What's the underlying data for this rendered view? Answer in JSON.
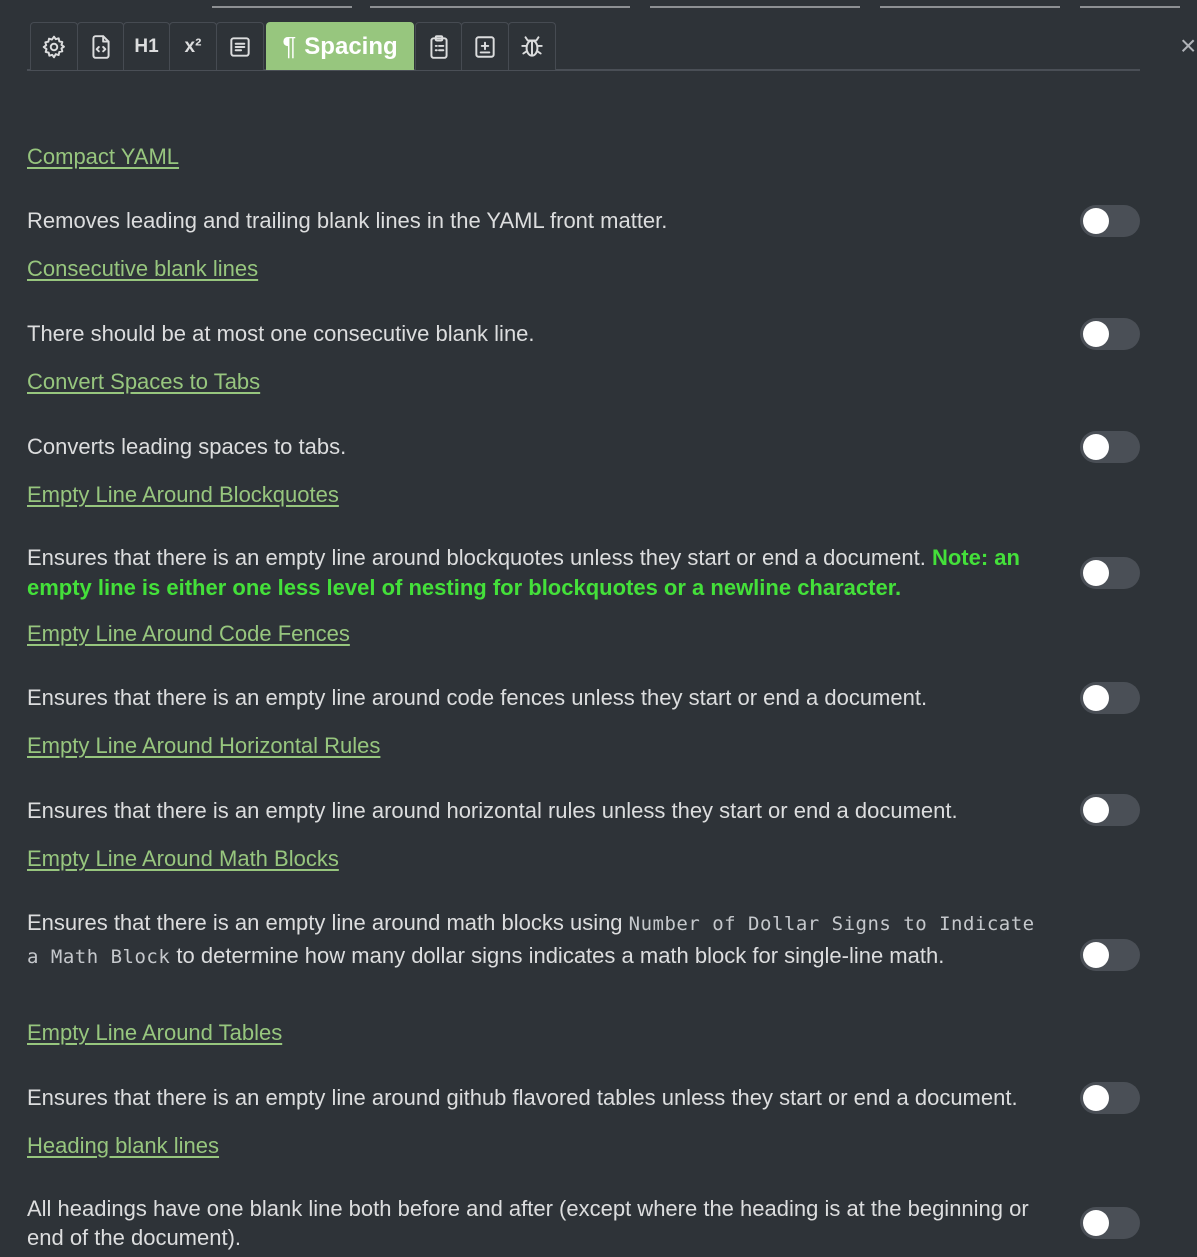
{
  "tabs": [
    {
      "name": "tab-general",
      "icon": "gear-icon"
    },
    {
      "name": "tab-yaml",
      "icon": "file-code-icon"
    },
    {
      "name": "tab-heading",
      "label": "H1"
    },
    {
      "name": "tab-footnote",
      "label": "x²"
    },
    {
      "name": "tab-content",
      "icon": "list-icon"
    },
    {
      "name": "tab-spacing",
      "label": "Spacing",
      "glyph": "¶",
      "active": true
    },
    {
      "name": "tab-paste",
      "icon": "clipboard-icon"
    },
    {
      "name": "tab-custom",
      "icon": "file-plus-icon"
    },
    {
      "name": "tab-debug",
      "icon": "bug-icon"
    }
  ],
  "close": {
    "label": "×"
  },
  "rules": [
    {
      "title": "Compact YAML",
      "description": "Removes leading and trailing blank lines in the YAML front matter.",
      "enabled": false
    },
    {
      "title": "Consecutive blank lines",
      "description": "There should be at most one consecutive blank line.",
      "enabled": false
    },
    {
      "title": "Convert Spaces to Tabs",
      "description": "Converts leading spaces to tabs.",
      "enabled": false
    },
    {
      "title": "Empty Line Around Blockquotes",
      "description": "Ensures that there is an empty line around blockquotes unless they start or end a document.",
      "note": "Note: an empty line is either one less level of nesting for blockquotes or a newline character.",
      "enabled": false
    },
    {
      "title": "Empty Line Around Code Fences",
      "description": "Ensures that there is an empty line around code fences unless they start or end a document.",
      "enabled": false
    },
    {
      "title": "Empty Line Around Horizontal Rules",
      "description": "Ensures that there is an empty line around horizontal rules unless they start or end a document.",
      "enabled": false
    },
    {
      "title": "Empty Line Around Math Blocks",
      "description_pre": "Ensures that there is an empty line around math blocks using",
      "description_code": "Number of Dollar Signs to Indicate a Math Block",
      "description_post": "to determine how many dollar signs indicates a math block for single-line math.",
      "enabled": false
    },
    {
      "title": "Empty Line Around Tables",
      "description": "Ensures that there is an empty line around github flavored tables unless they start or end a document.",
      "enabled": false
    },
    {
      "title": "Heading blank lines",
      "description": "All headings have one blank line both before and after (except where the heading is at the beginning or end of the document).",
      "enabled": false
    }
  ]
}
